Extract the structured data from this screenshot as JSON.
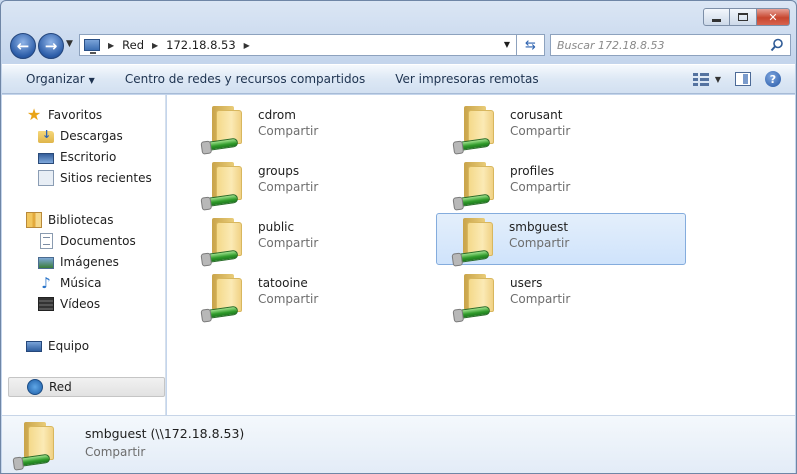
{
  "window": {
    "minimize_icon": "minimize-icon",
    "maximize_icon": "maximize-icon",
    "close_icon": "close-icon"
  },
  "address": {
    "root": "Red",
    "host": "172.18.8.53",
    "search_placeholder": "Buscar 172.18.8.53"
  },
  "toolbar": {
    "organize": "Organizar",
    "network_center": "Centro de redes y recursos compartidos",
    "remote_printers": "Ver impresoras remotas"
  },
  "sidebar": {
    "favorites": {
      "label": "Favoritos",
      "items": [
        "Descargas",
        "Escritorio",
        "Sitios recientes"
      ]
    },
    "libraries": {
      "label": "Bibliotecas",
      "items": [
        "Documentos",
        "Imágenes",
        "Música",
        "Vídeos"
      ]
    },
    "computer": "Equipo",
    "network": "Red"
  },
  "shares": [
    {
      "name": "cdrom",
      "type": "Compartir"
    },
    {
      "name": "corusant",
      "type": "Compartir"
    },
    {
      "name": "groups",
      "type": "Compartir"
    },
    {
      "name": "profiles",
      "type": "Compartir"
    },
    {
      "name": "public",
      "type": "Compartir"
    },
    {
      "name": "smbguest",
      "type": "Compartir",
      "selected": true
    },
    {
      "name": "tatooine",
      "type": "Compartir"
    },
    {
      "name": "users",
      "type": "Compartir"
    }
  ],
  "details": {
    "name": "smbguest (\\\\172.18.8.53)",
    "type": "Compartir"
  },
  "colors": {
    "selection_fill": "#cfe3fb",
    "selection_border": "#84acdd",
    "close_button": "#c7462f"
  }
}
